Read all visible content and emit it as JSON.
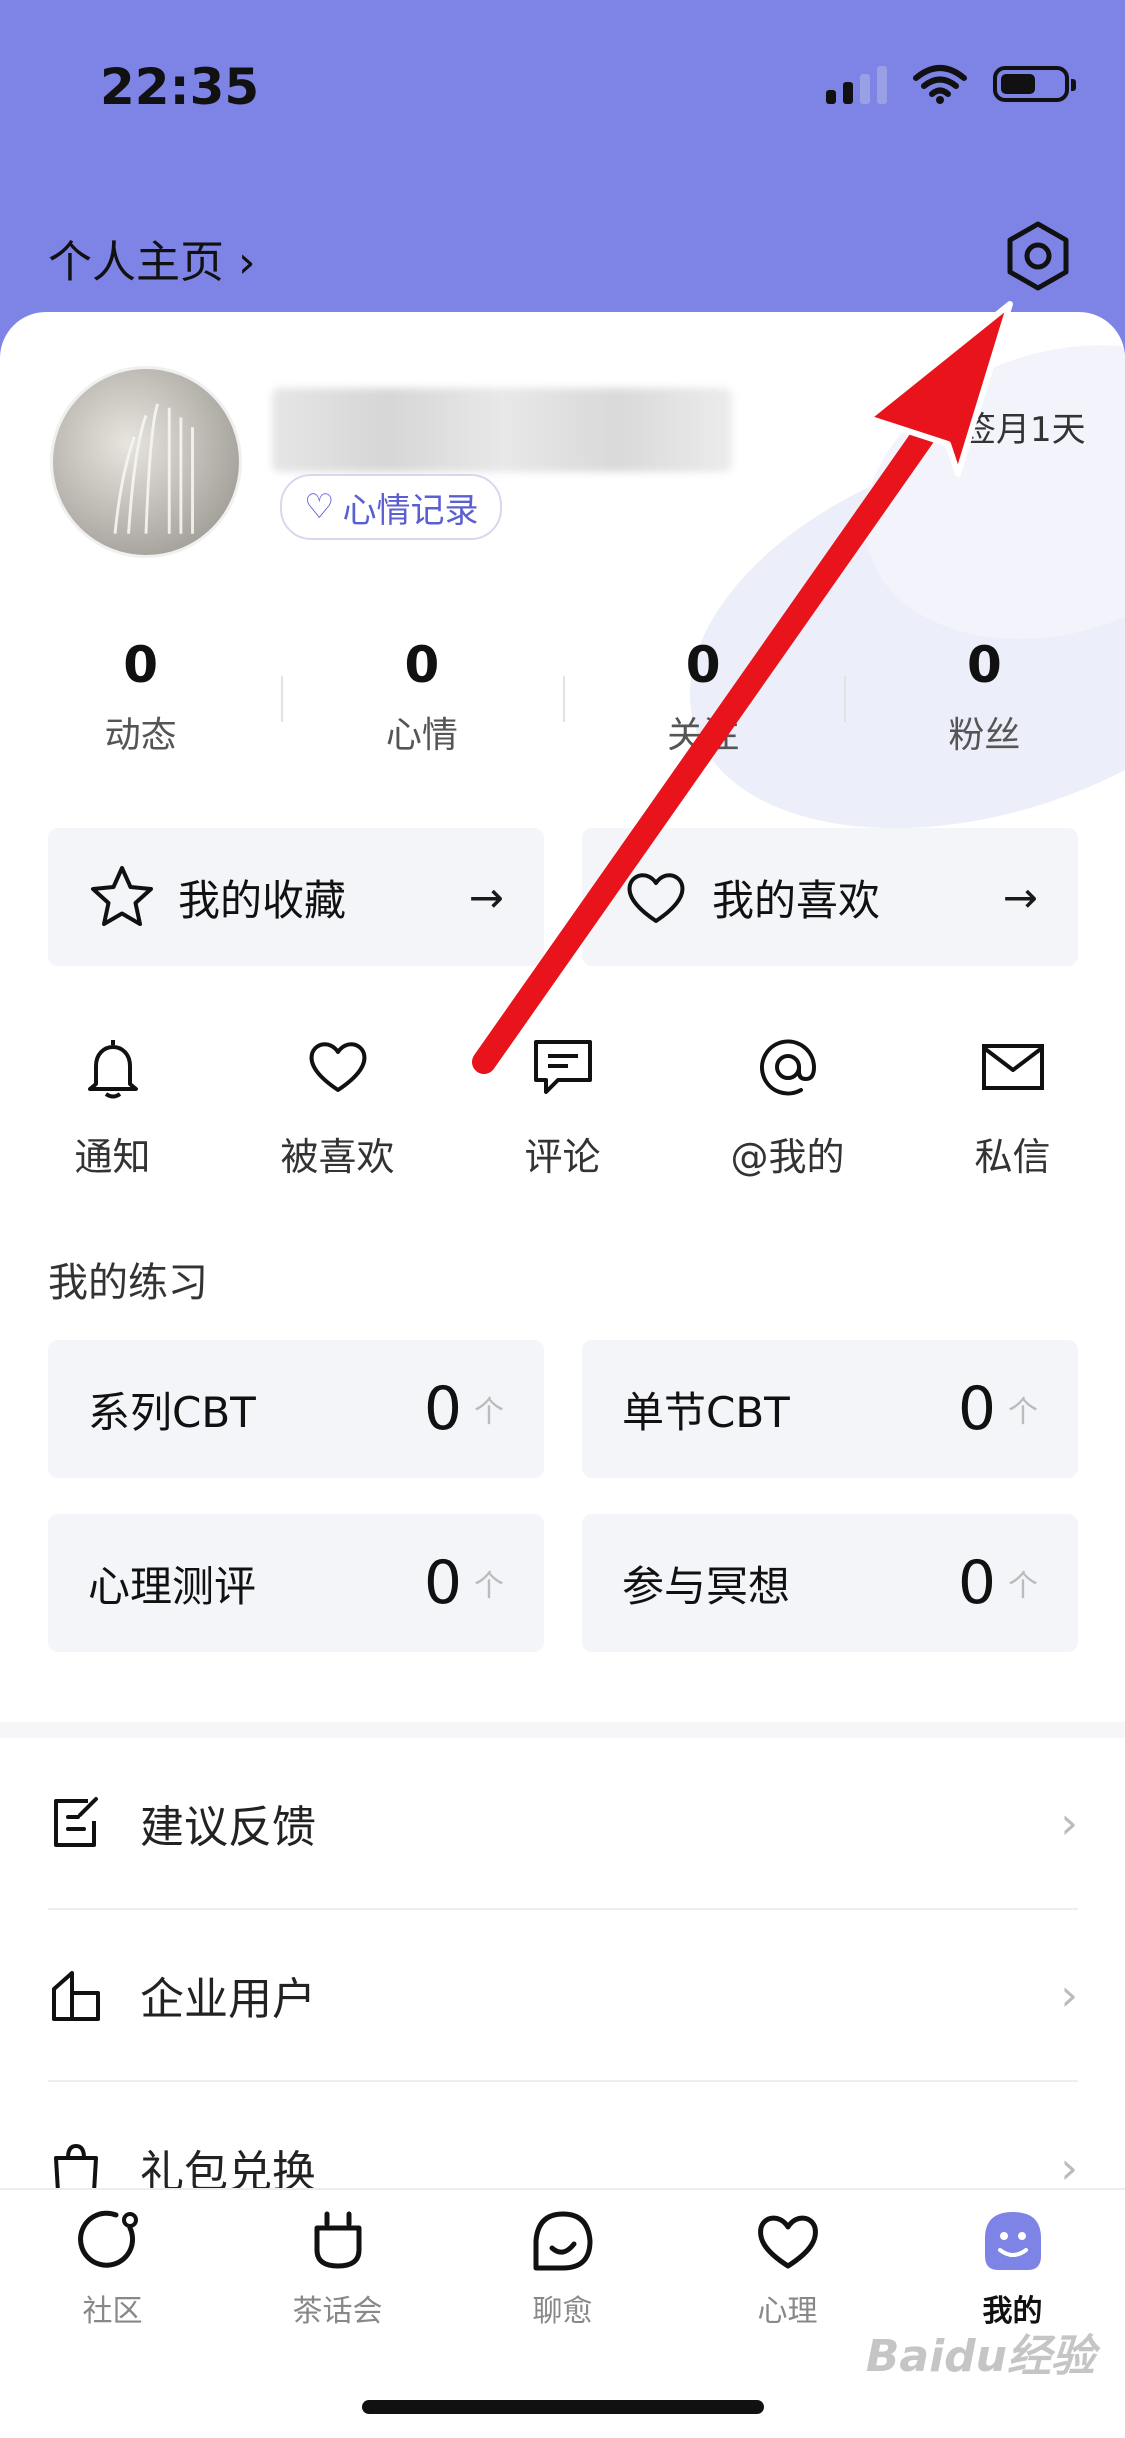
{
  "status_bar": {
    "time": "22:35"
  },
  "header": {
    "profile_link": "个人主页 ›"
  },
  "profile": {
    "mood_record": "心情记录",
    "sign_text": "签月1天"
  },
  "stats": [
    {
      "value": "0",
      "label": "动态"
    },
    {
      "value": "0",
      "label": "心情"
    },
    {
      "value": "0",
      "label": "关注"
    },
    {
      "value": "0",
      "label": "粉丝"
    }
  ],
  "collections": {
    "favorites": "我的收藏",
    "likes": "我的喜欢"
  },
  "quick_actions": [
    {
      "label": "通知",
      "icon": "bell-icon"
    },
    {
      "label": "被喜欢",
      "icon": "heart-icon"
    },
    {
      "label": "评论",
      "icon": "comment-icon"
    },
    {
      "label": "@我的",
      "icon": "at-icon"
    },
    {
      "label": "私信",
      "icon": "mail-icon"
    }
  ],
  "practice": {
    "title": "我的练习",
    "items": [
      {
        "label": "系列CBT",
        "value": "0",
        "unit": "个"
      },
      {
        "label": "单节CBT",
        "value": "0",
        "unit": "个"
      },
      {
        "label": "心理测评",
        "value": "0",
        "unit": "个"
      },
      {
        "label": "参与冥想",
        "value": "0",
        "unit": "个"
      }
    ]
  },
  "menu": [
    {
      "label": "建议反馈",
      "icon": "feedback-icon"
    },
    {
      "label": "企业用户",
      "icon": "building-icon"
    },
    {
      "label": "礼包兑换",
      "icon": "gift-bag-icon"
    }
  ],
  "tabbar": [
    {
      "label": "社区",
      "icon": "community-icon"
    },
    {
      "label": "茶话会",
      "icon": "tea-party-icon"
    },
    {
      "label": "聊愈",
      "icon": "chat-heal-icon"
    },
    {
      "label": "心理",
      "icon": "heart-icon"
    },
    {
      "label": "我的",
      "icon": "me-icon",
      "active": true
    }
  ],
  "watermark": "Baidu经验",
  "colors": {
    "header_bg": "#7e83e6",
    "accent": "#5c5fd1",
    "annotation_arrow": "#e8131b"
  }
}
